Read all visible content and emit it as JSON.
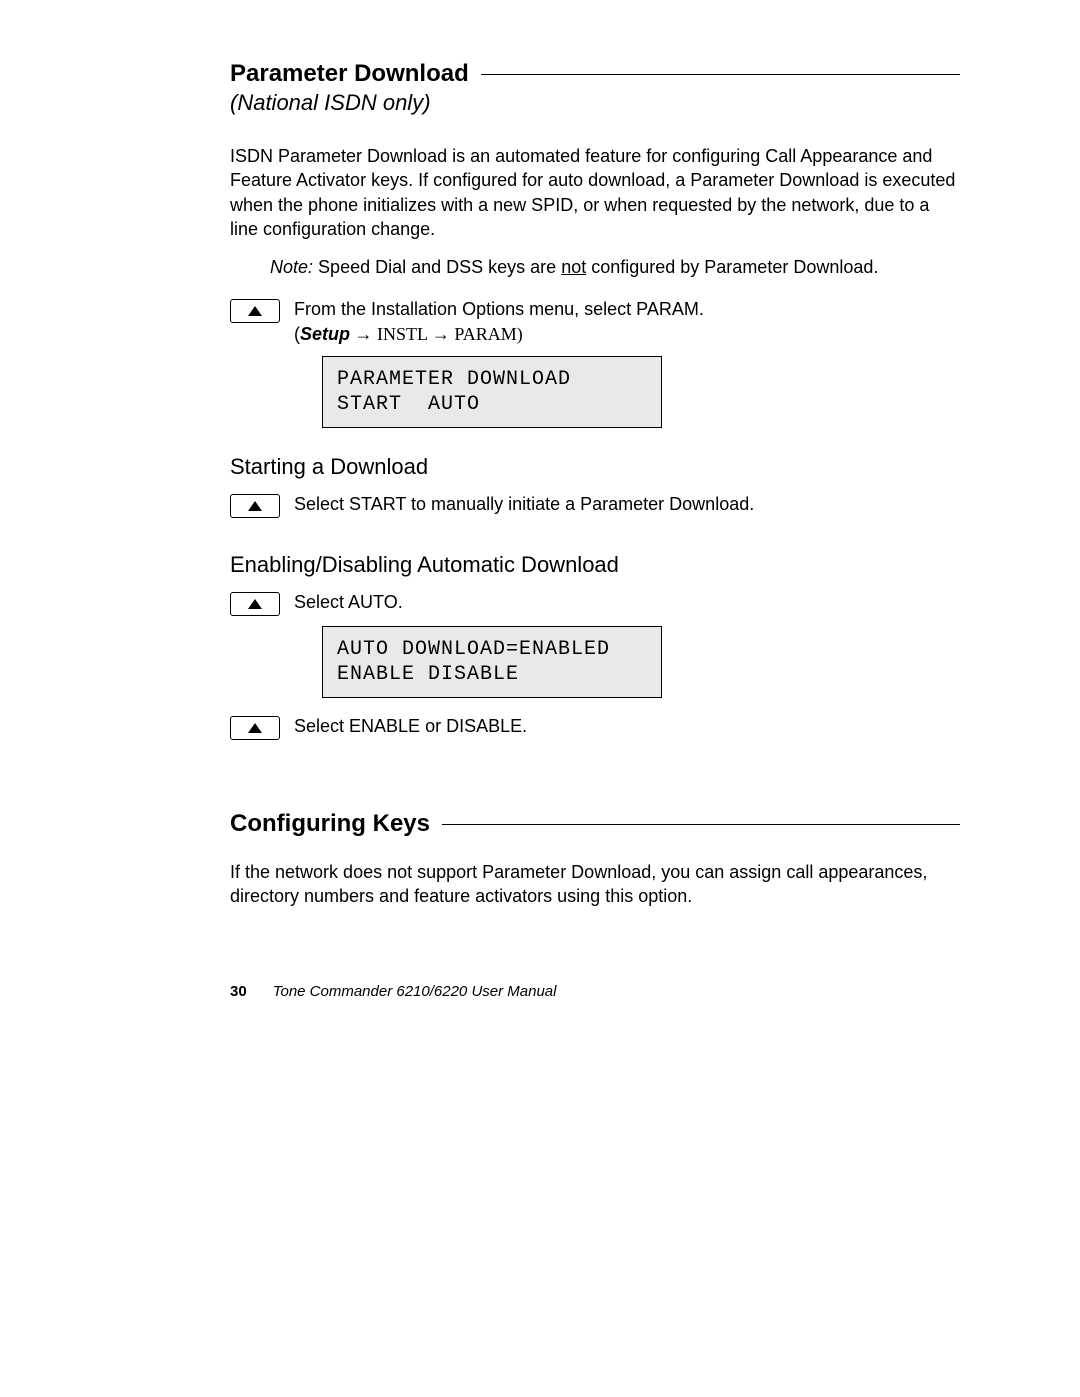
{
  "section1": {
    "title": "Parameter Download",
    "subtitle": "(National ISDN only)",
    "intro": "ISDN Parameter Download is an automated feature for configuring Call Appearance and Feature Activator keys. If configured for auto download, a Parameter Download is executed when the phone initializes with a new SPID, or when requested by the network, due to a line configuration change.",
    "note_label": "Note",
    "note_before": "Speed Dial and DSS keys are ",
    "note_underline": "not",
    "note_after": " configured by Parameter Download.",
    "action1_line1": "From the Installation Options menu, select PARAM.",
    "action1_setup": "Setup",
    "action1_path_rest": " → INSTL → PARAM)",
    "display1_line1": "PARAMETER DOWNLOAD",
    "display1_line2": "START  AUTO"
  },
  "section2": {
    "heading": "Starting a Download",
    "action": "Select START to manually initiate a Parameter Download."
  },
  "section3": {
    "heading": "Enabling/Disabling Automatic Download",
    "action1": "Select AUTO.",
    "display_line1": "AUTO DOWNLOAD=ENABLED",
    "display_line2": "ENABLE DISABLE",
    "action2": "Select ENABLE or DISABLE."
  },
  "section4": {
    "title": "Configuring Keys",
    "intro": "If the network does not support Parameter Download, you can assign call appearances, directory numbers and feature activators using this option."
  },
  "footer": {
    "page": "30",
    "title": "Tone Commander 6210/6220 User Manual"
  }
}
